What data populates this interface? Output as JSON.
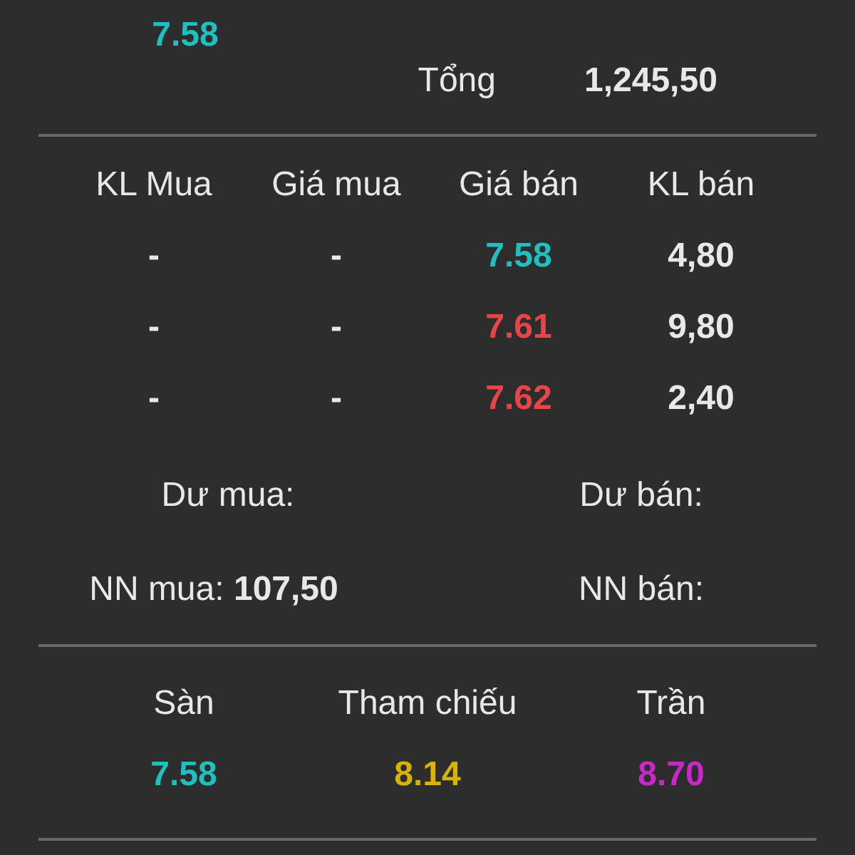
{
  "summary": {
    "price": {
      "value": "7.58",
      "color": "#20c0c0"
    },
    "total": {
      "label": "Tổng",
      "value": "1,245,50"
    }
  },
  "order_book": {
    "columns": [
      "KL Mua",
      "Giá mua",
      "Giá bán",
      "KL bán"
    ],
    "rows": [
      {
        "buy_volume": "-",
        "buy_price": "-",
        "sell_price": "7.58",
        "color": "#20c0c0",
        "sell_volume": "4,80"
      },
      {
        "buy_volume": "-",
        "buy_price": "-",
        "sell_price": "7.61",
        "color": "#e84646",
        "sell_volume": "9,80"
      },
      {
        "buy_volume": "-",
        "buy_price": "-",
        "sell_price": "7.62",
        "color": "#e84646",
        "sell_volume": "2,40"
      }
    ]
  },
  "surplus": {
    "buy_label": "Dư mua:",
    "sell_label": "Dư bán:"
  },
  "foreign": {
    "buy_label": "NN mua:",
    "buy_value": "107,50",
    "sell_label": "NN bán:"
  },
  "reference": [
    {
      "label": "Sàn",
      "value": "7.58",
      "color": "#20c0c0"
    },
    {
      "label": "Tham chiếu",
      "value": "8.14",
      "color": "#d8b400"
    },
    {
      "label": "Trần",
      "value": "8.70",
      "color": "#c828c8"
    }
  ]
}
